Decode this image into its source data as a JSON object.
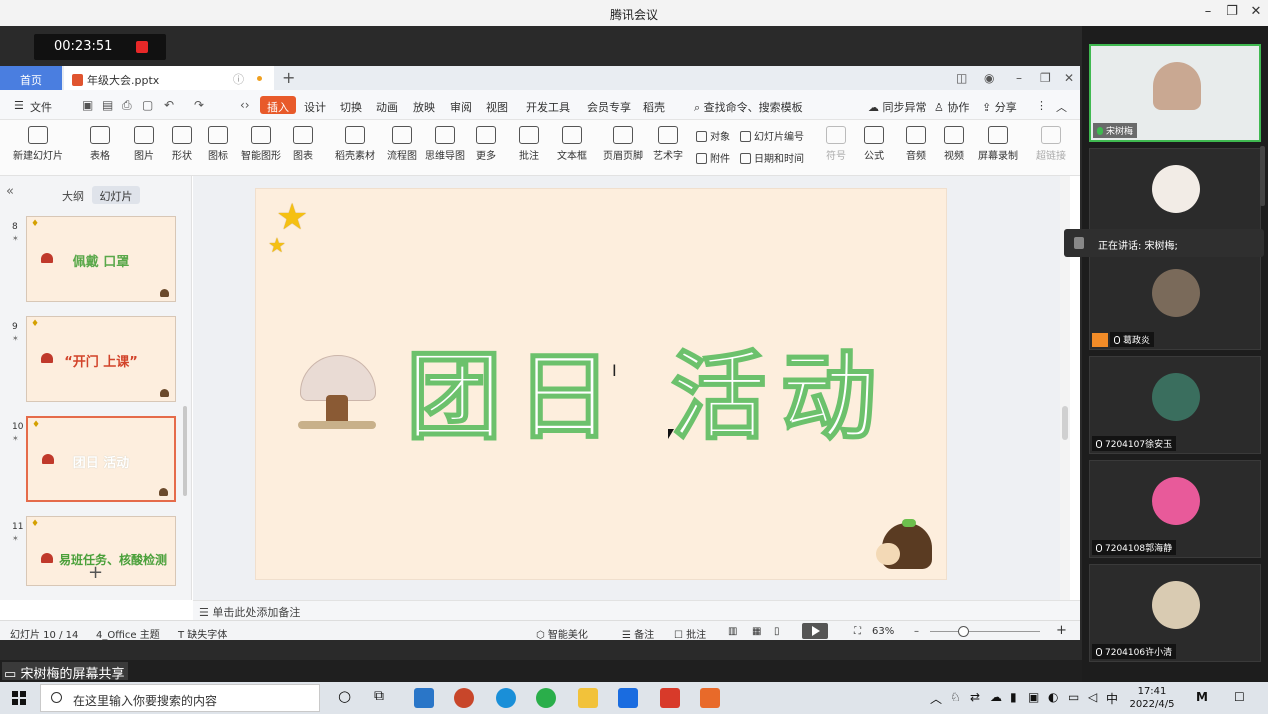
{
  "window": {
    "title": "腾讯会议",
    "min": "–",
    "restore": "❐",
    "close": "✕"
  },
  "meeting": {
    "timer": "00:23:51",
    "share_label": "宋树梅的屏幕共享",
    "speaking_label": "正在讲话: 宋树梅;"
  },
  "wps": {
    "home_tab": "首页",
    "file_tab": "年级大会.pptx",
    "menu": {
      "file": "文件",
      "insert": "插入",
      "items": [
        "设计",
        "切换",
        "动画",
        "放映",
        "审阅",
        "视图",
        "开发工具",
        "会员专享",
        "稻壳"
      ],
      "search_placeholder": "查找命令、搜索模板",
      "sync": "同步异常",
      "collab": "协作",
      "share": "分享"
    },
    "ribbon": {
      "buttons": [
        "新建幻灯片",
        "表格",
        "图片",
        "形状",
        "图标",
        "智能图形",
        "图表",
        "稻壳素材",
        "流程图",
        "思维导图",
        "更多",
        "批注",
        "文本框",
        "页眉页脚",
        "艺术字"
      ],
      "small": [
        "对象",
        "附件",
        "幻灯片编号",
        "日期和时间"
      ],
      "right_buttons": [
        "符号",
        "公式",
        "音频",
        "视频",
        "屏幕录制",
        "超链接"
      ]
    },
    "panel": {
      "outline_tab": "大纲",
      "slides_tab": "幻灯片",
      "add": "+"
    },
    "thumbnails": [
      {
        "num": "8",
        "title": "佩戴 口罩",
        "color": "#5aa84a"
      },
      {
        "num": "9",
        "title": "“开门 上课”",
        "color": "#d2432a"
      },
      {
        "num": "10",
        "title": "团日 活动",
        "color": "#ffffff"
      },
      {
        "num": "11",
        "title": "易班任务、核酸检测",
        "color": "#4aa03a"
      }
    ],
    "slide": {
      "title": "团日 活动"
    },
    "notes": "单击此处添加备注",
    "status": {
      "slide_count": "幻灯片 10 / 14",
      "theme": "4_Office 主题",
      "missing_font": "缺失字体",
      "smart": "智能美化",
      "notes": "备注",
      "comments": "批注",
      "zoom": "63%"
    }
  },
  "participants": [
    {
      "name": "宋树梅",
      "mic": "on",
      "active": true
    },
    {
      "name": "",
      "mic": "off",
      "active": false
    },
    {
      "name": "葛政炎",
      "mic": "off",
      "active": false
    },
    {
      "name": "7204107徐安玉",
      "mic": "off",
      "active": false
    },
    {
      "name": "7204108郭海静",
      "mic": "off",
      "active": false
    },
    {
      "name": "7204106许小清",
      "mic": "off",
      "active": false
    }
  ],
  "taskbar": {
    "search_placeholder": "在这里输入你要搜索的内容",
    "ime": "中",
    "time": "17:41",
    "date": "2022/4/5"
  },
  "colors": {
    "accent": "#4a7ee0",
    "insert": "#e85a2a",
    "title_green": "#6cc16c",
    "active_border": "#3fb950"
  }
}
